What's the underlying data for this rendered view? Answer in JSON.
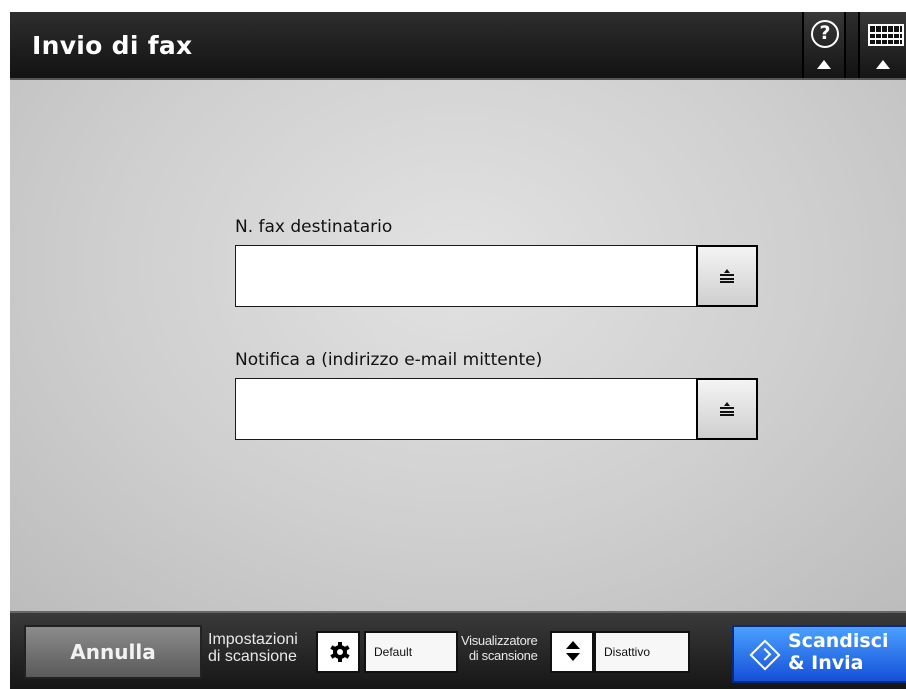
{
  "header": {
    "title": "Invio di fax",
    "help_icon": "help-icon",
    "keyboard_icon": "keyboard-icon"
  },
  "form": {
    "recipient_fax_label": "N. fax destinatario",
    "recipient_fax_value": "",
    "notify_label": "Notifica a (indirizzo e-mail mittente)",
    "notify_value": "",
    "list_icon": "list-select-icon"
  },
  "footer": {
    "cancel_label": "Annulla",
    "scan_settings_line1": "Impostazioni",
    "scan_settings_line2": "di scansione",
    "scan_settings_value": "Default",
    "scan_settings_icon": "gear-icon",
    "scan_viewer_line1": "Visualizzatore",
    "scan_viewer_line2": "di scansione",
    "scan_viewer_value": "Disattivo",
    "scan_viewer_icon": "up-down-arrows-icon",
    "scan_send_line1": "Scandisci",
    "scan_send_line2": "& Invia",
    "scan_send_icon": "start-diamond-icon"
  },
  "colors": {
    "header_bg": "#1e1e1e",
    "footer_bg": "#242424",
    "scan_button": "#2a78f0",
    "cancel_button": "#737373"
  }
}
